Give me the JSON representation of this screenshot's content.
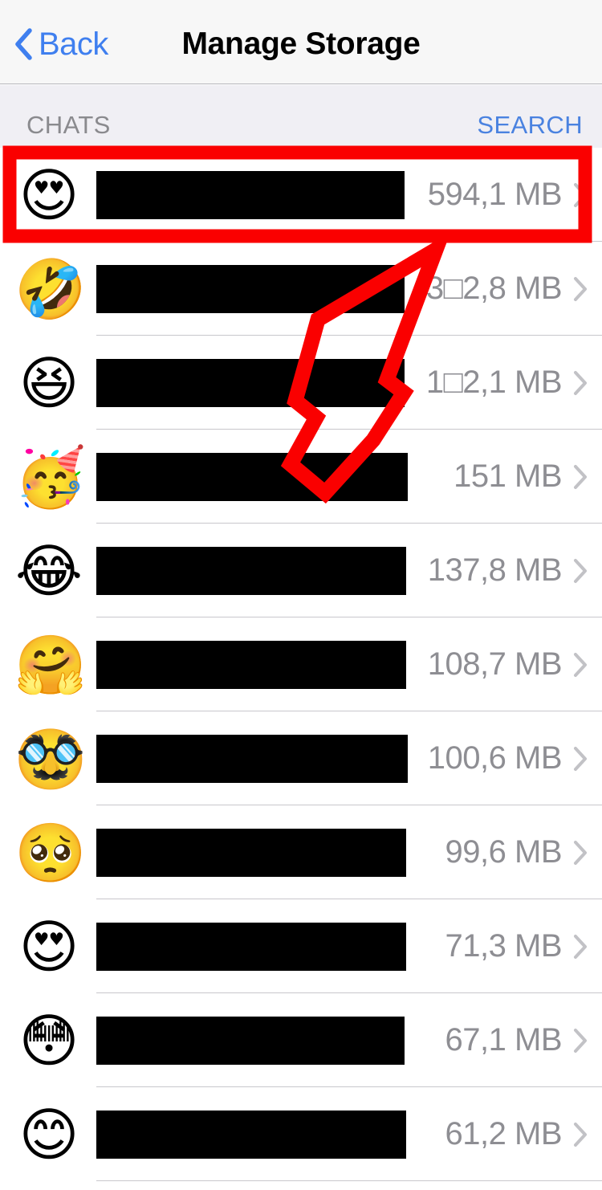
{
  "navbar": {
    "back_label": "Back",
    "title": "Manage Storage",
    "back_icon": "chevron-left-icon"
  },
  "section": {
    "title": "CHATS",
    "search_label": "SEARCH"
  },
  "colors": {
    "ios_blue": "#3f7fef",
    "search_blue": "#4a82e0",
    "size_gray": "#8e8e93",
    "section_gray": "#8a8a8e",
    "nav_background": "#f7f7f7",
    "section_background": "#f0eff4",
    "separator": "#c8c7cc",
    "annotation_red": "#fa0000",
    "redaction_black": "#000000"
  },
  "annotations": {
    "highlight_box": {
      "shape": "rectangle",
      "color": "#fa0000",
      "target_row_index": 0
    },
    "pointer": {
      "shape": "outlined-arrow",
      "color": "#fa0000",
      "direction": "up-right",
      "points_at_row_index": 0
    }
  },
  "chats": [
    {
      "avatar_emoji": "😍",
      "avatar_name": "smiling-face-with-heart-eyes",
      "name_redacted": true,
      "redaction_width": 384,
      "size": "594,1 MB",
      "chevron": "chevron-right-icon",
      "highlighted": true
    },
    {
      "avatar_emoji": "🤣",
      "avatar_name": "rolling-on-the-floor-laughing",
      "name_redacted": true,
      "redaction_width": 384,
      "size": "3□2,8 MB",
      "chevron": "chevron-right-icon",
      "highlighted": false
    },
    {
      "avatar_emoji": "😆",
      "avatar_name": "grinning-squinting-face",
      "name_redacted": true,
      "redaction_width": 384,
      "size": "1□2,1 MB",
      "chevron": "chevron-right-icon",
      "highlighted": false
    },
    {
      "avatar_emoji": "🥳",
      "avatar_name": "partying-face",
      "name_redacted": true,
      "redaction_width": 388,
      "size": "151 MB",
      "chevron": "chevron-right-icon",
      "highlighted": false
    },
    {
      "avatar_emoji": "😂",
      "avatar_name": "face-with-tears-of-joy",
      "name_redacted": true,
      "redaction_width": 386,
      "size": "137,8 MB",
      "chevron": "chevron-right-icon",
      "highlighted": false
    },
    {
      "avatar_emoji": "🤗",
      "avatar_name": "hugging-face",
      "name_redacted": true,
      "redaction_width": 386,
      "size": "108,7 MB",
      "chevron": "chevron-right-icon",
      "highlighted": false
    },
    {
      "avatar_emoji": "🥸",
      "avatar_name": "disguised-face",
      "name_redacted": true,
      "redaction_width": 388,
      "size": "100,6 MB",
      "chevron": "chevron-right-icon",
      "highlighted": false
    },
    {
      "avatar_emoji": "🥺",
      "avatar_name": "pleading-face",
      "name_redacted": true,
      "redaction_width": 386,
      "size": "99,6 MB",
      "chevron": "chevron-right-icon",
      "highlighted": false
    },
    {
      "avatar_emoji": "😍",
      "avatar_name": "smiling-face-with-heart-eyes",
      "name_redacted": true,
      "redaction_width": 386,
      "size": "71,3 MB",
      "chevron": "chevron-right-icon",
      "highlighted": false
    },
    {
      "avatar_emoji": "😳",
      "avatar_name": "flushed-face",
      "name_redacted": true,
      "redaction_width": 384,
      "size": "67,1 MB",
      "chevron": "chevron-right-icon",
      "highlighted": false
    },
    {
      "avatar_emoji": "😊",
      "avatar_name": "smiling-face-with-smiling-eyes",
      "name_redacted": true,
      "redaction_width": 386,
      "size": "61,2 MB",
      "chevron": "chevron-right-icon",
      "highlighted": false
    }
  ]
}
